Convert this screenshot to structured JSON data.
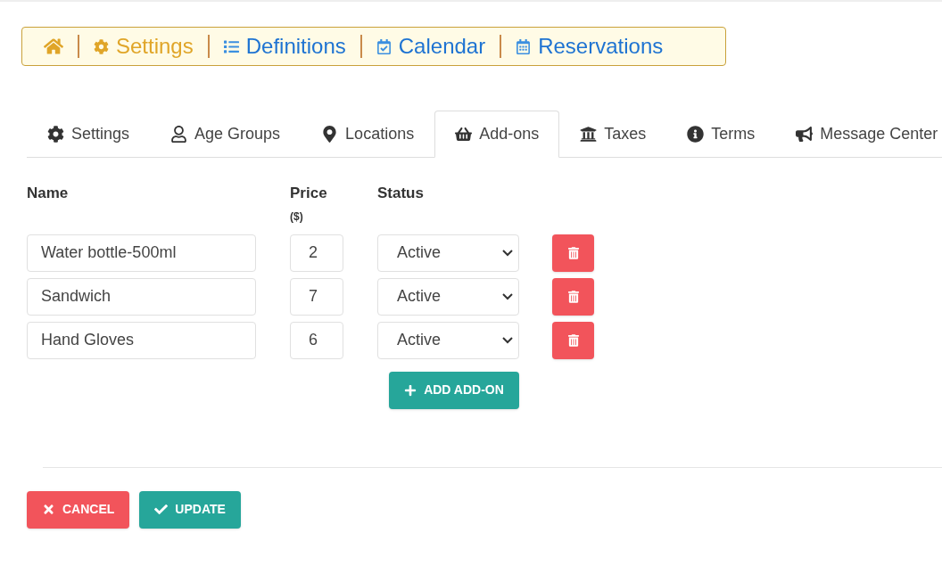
{
  "breadcrumb": [
    {
      "label": "Settings",
      "selected": true
    },
    {
      "label": "Definitions",
      "selected": false
    },
    {
      "label": "Calendar",
      "selected": false
    },
    {
      "label": "Reservations",
      "selected": false
    }
  ],
  "tabs": [
    {
      "label": "Settings",
      "selected": false
    },
    {
      "label": "Age Groups",
      "selected": false
    },
    {
      "label": "Locations",
      "selected": false
    },
    {
      "label": "Add-ons",
      "selected": true
    },
    {
      "label": "Taxes",
      "selected": false
    },
    {
      "label": "Terms",
      "selected": false
    },
    {
      "label": "Message Center",
      "selected": false
    }
  ],
  "table": {
    "columns": [
      {
        "label": "Name"
      },
      {
        "label": "Price",
        "sub": "($)"
      },
      {
        "label": "Status"
      }
    ],
    "rows": [
      {
        "name": "Water bottle-500ml",
        "price": "2",
        "status": "Active"
      },
      {
        "name": "Sandwich",
        "price": "7",
        "status": "Active"
      },
      {
        "name": "Hand Gloves",
        "price": "6",
        "status": "Active"
      }
    ]
  },
  "add_button": "ADD ADD-ON",
  "buttons": [
    {
      "kind": "cancel",
      "label": "CANCEL"
    },
    {
      "kind": "update",
      "label": "UPDATE"
    }
  ]
}
